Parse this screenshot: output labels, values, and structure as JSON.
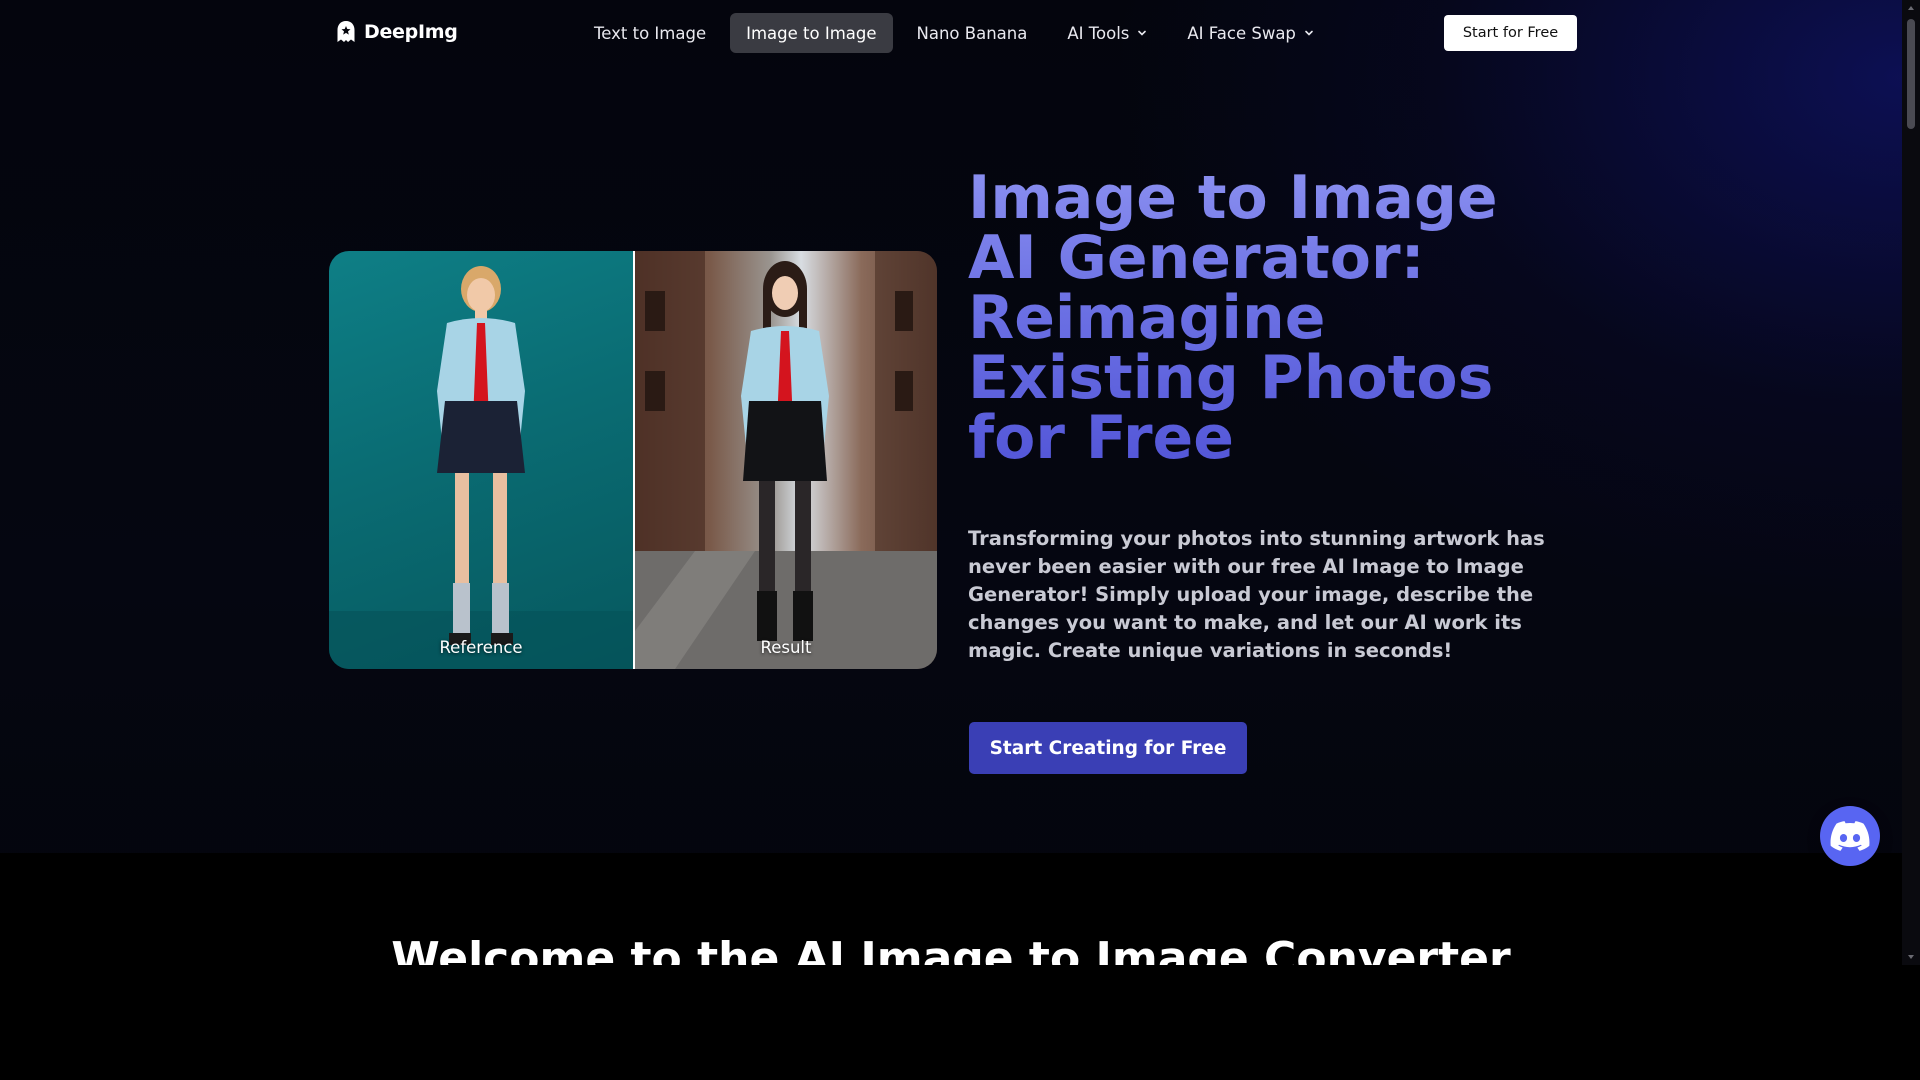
{
  "nav": {
    "brand": "DeepImg",
    "links": [
      {
        "label": "Text to Image"
      },
      {
        "label": "Image to Image",
        "active": true
      },
      {
        "label": "Nano Banana"
      },
      {
        "label": "AI Tools",
        "has_dropdown": true
      },
      {
        "label": "AI Face Swap",
        "has_dropdown": true
      }
    ],
    "cta": "Start for Free"
  },
  "hero": {
    "comparison": {
      "left_label": "Reference",
      "right_label": "Result"
    },
    "title": "Image to Image AI Generator: Reimagine Existing Photos for Free",
    "description": "Transforming your photos into stunning artwork has never been easier with our free AI Image to Image Generator! Simply upload your image, describe the changes you want to make, and let our AI work its magic. Create unique variations in seconds!",
    "cta": "Start Creating for Free"
  },
  "section": {
    "title": "Welcome to the AI Image to Image Converter"
  },
  "icons": {
    "logo": "ghost-logo-icon",
    "dropdown": "chevron-down-icon",
    "chat": "discord-icon"
  },
  "colors": {
    "title_gradient": "#6c71e4",
    "cta_bg": "#3a3fb5",
    "discord": "#5865f2",
    "active_nav": "#3a3b42"
  }
}
